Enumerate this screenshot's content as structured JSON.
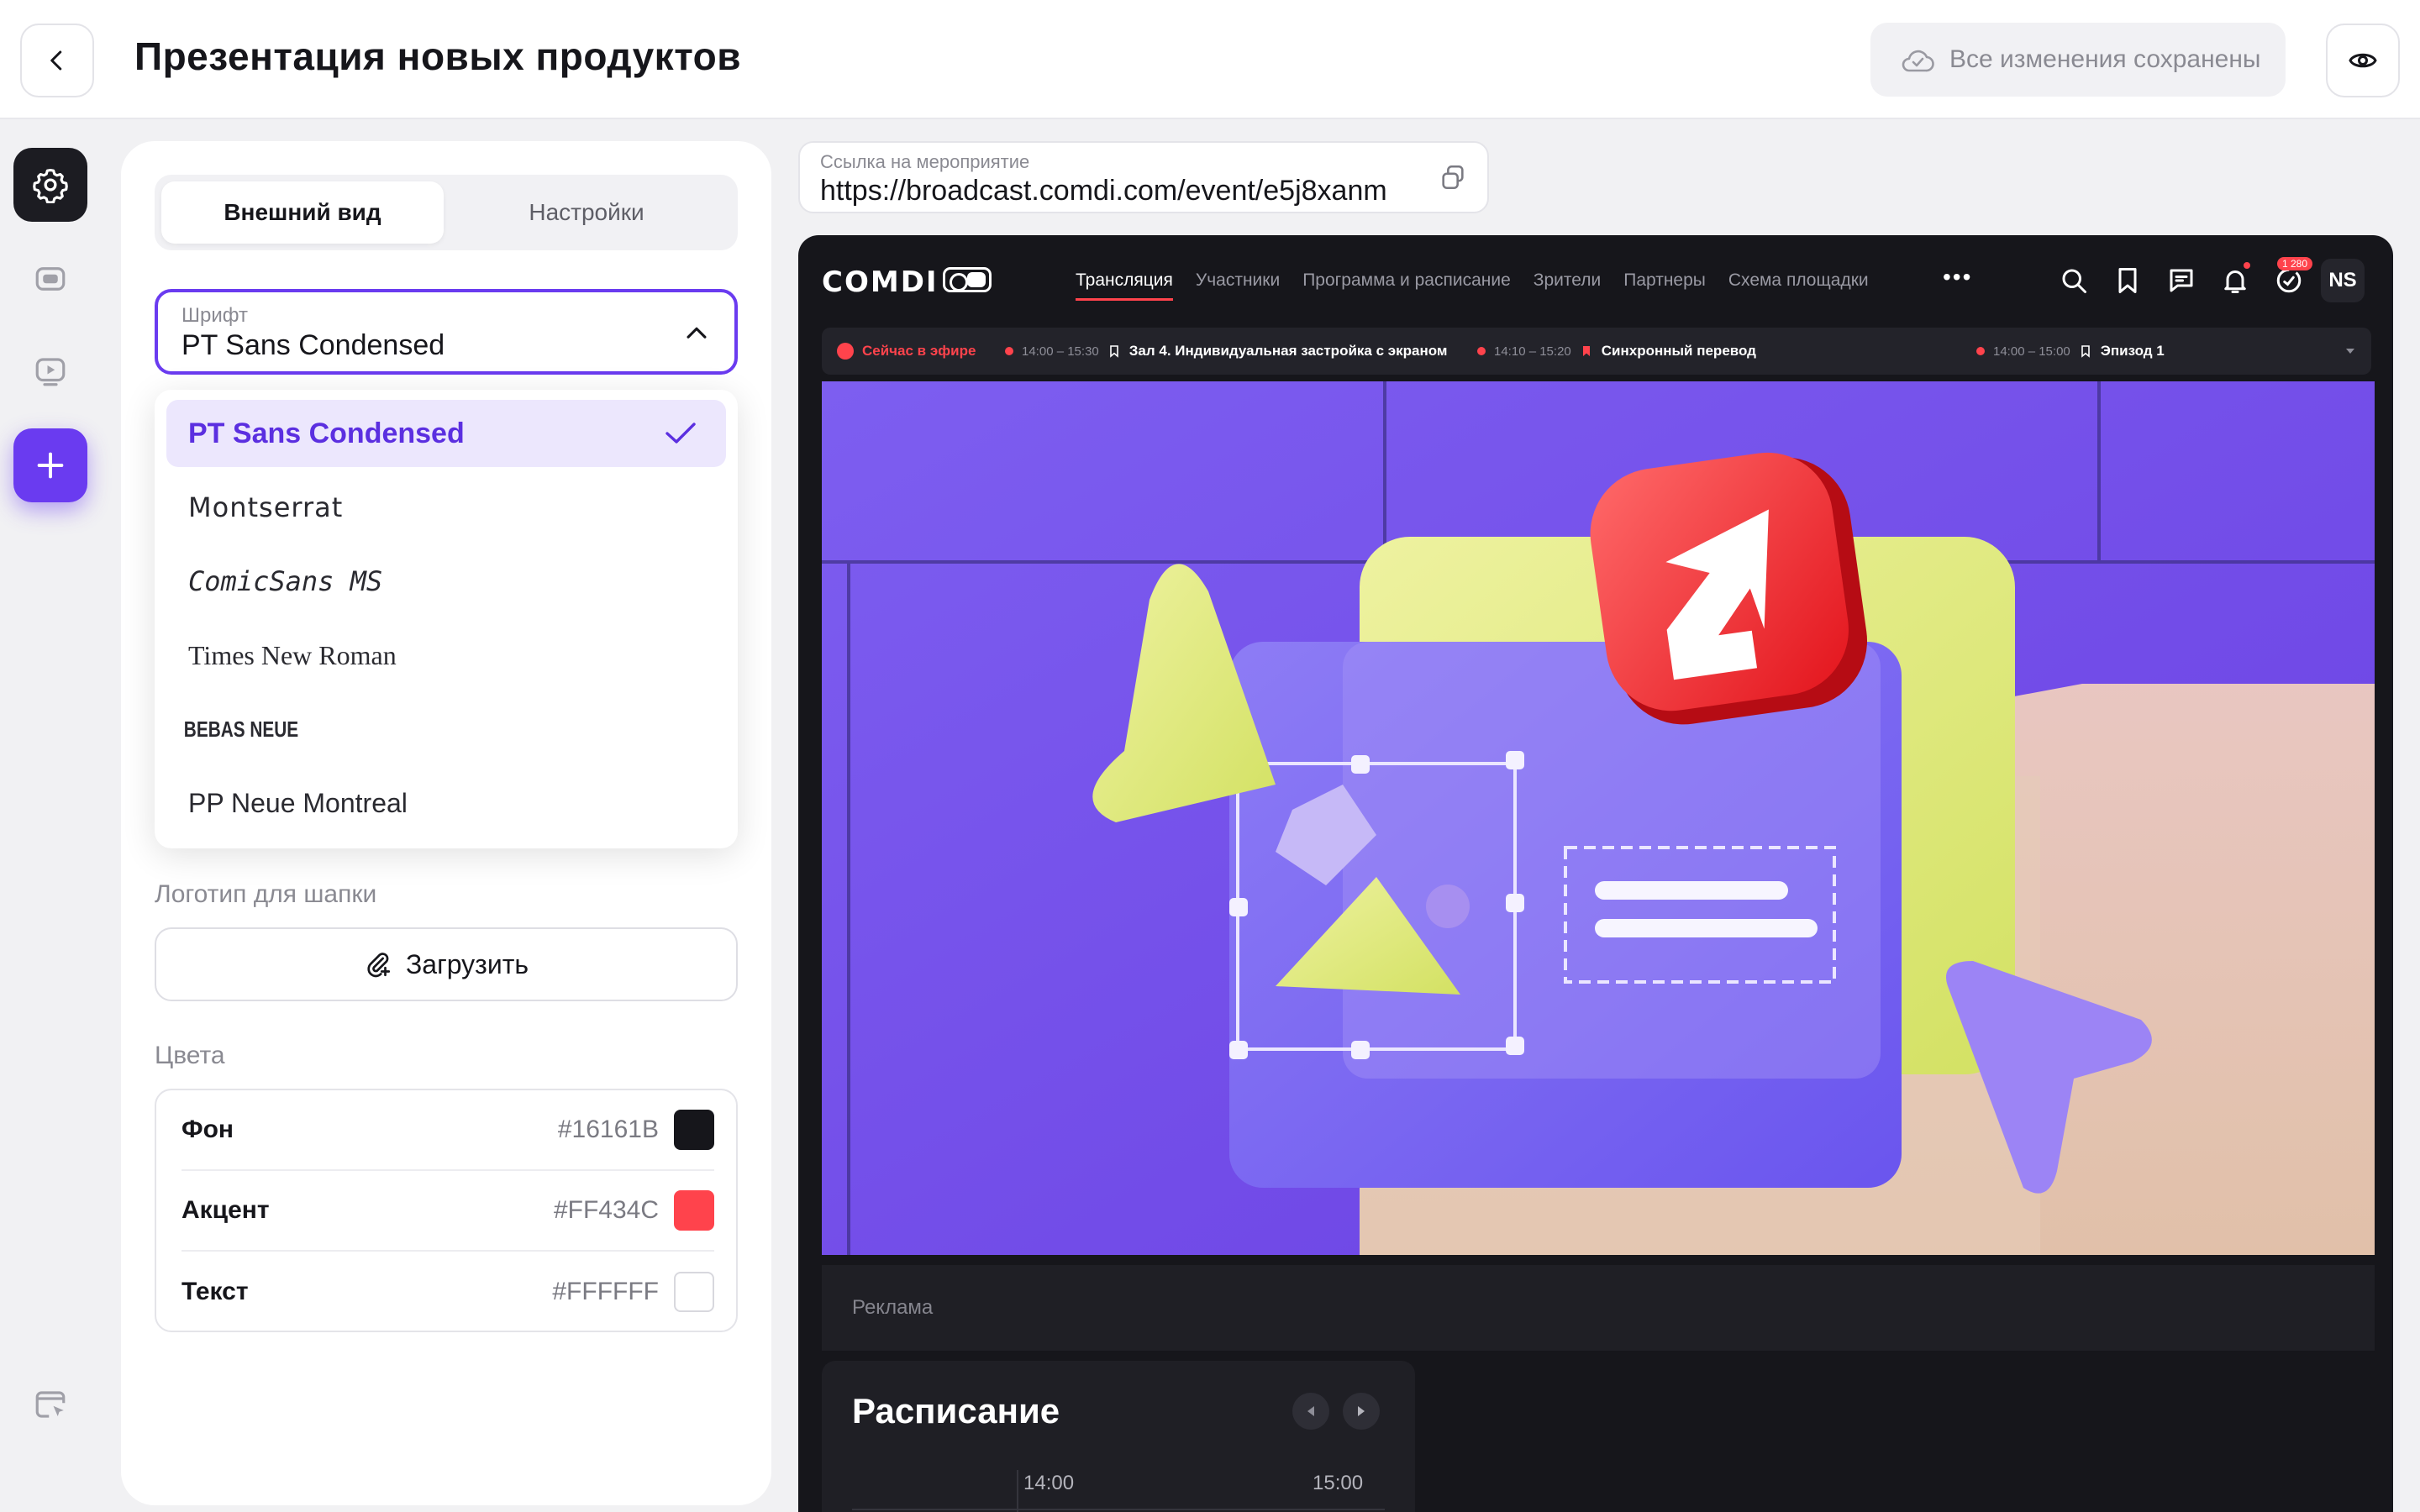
{
  "header": {
    "title": "Презентация новых продуктов",
    "save_status": "Все изменения сохранены"
  },
  "tabs": {
    "appearance": "Внешний вид",
    "settings": "Настройки"
  },
  "font_select": {
    "label": "Шрифт",
    "value": "PT Sans Condensed",
    "options": [
      "PT Sans Condensed",
      "Montserrat",
      "ComicSans MS",
      "Times New Roman",
      "BEBAS NEUE",
      "PP Neue Montreal"
    ]
  },
  "logo": {
    "label": "Логотип для шапки",
    "upload": "Загрузить"
  },
  "colors": {
    "label": "Цвета",
    "items": [
      {
        "name": "Фон",
        "hex": "#16161B"
      },
      {
        "name": "Акцент",
        "hex": "#FF434C"
      },
      {
        "name": "Текст",
        "hex": "#FFFFFF"
      }
    ]
  },
  "event_link": {
    "label": "Ссылка на мероприятие",
    "url": "https://broadcast.comdi.com/event/e5j8xanm"
  },
  "preview": {
    "logo": "COMDI",
    "nav": [
      "Трансляция",
      "Участники",
      "Программа и расписание",
      "Зрители",
      "Партнеры",
      "Схема площадки"
    ],
    "badge": "1 280",
    "avatar": "NS",
    "ticker": {
      "live": "Сейчас в эфире",
      "items": [
        {
          "time": "14:00 – 15:30",
          "title": "Зал 4. Индивидуальная застройка с экраном"
        },
        {
          "time": "14:10 – 15:20",
          "title": "Синхронный перевод"
        },
        {
          "time": "14:00 – 15:00",
          "title": "Эпизод 1"
        }
      ]
    },
    "ads": "Реклама",
    "schedule": {
      "title": "Расписание",
      "times": [
        "14:00",
        "15:00"
      ]
    }
  },
  "palette": {
    "accent": "#6A3BF0",
    "live": "#FF434C",
    "bg": "#16161B"
  }
}
